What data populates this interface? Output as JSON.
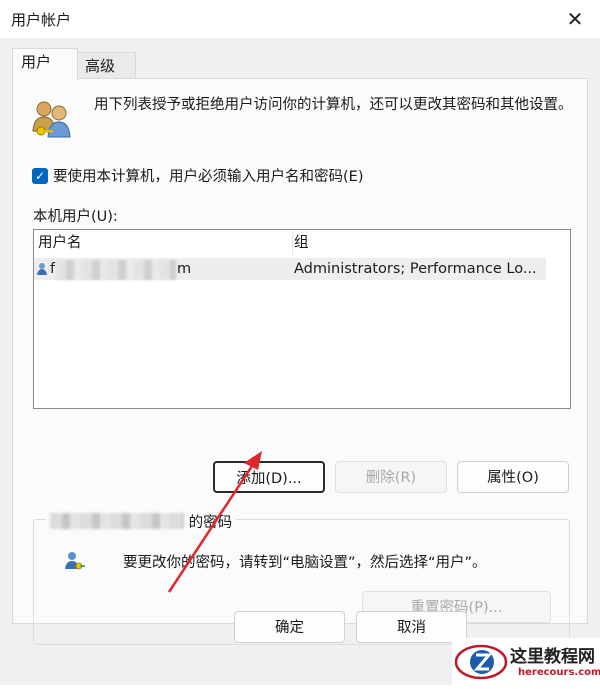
{
  "window": {
    "title": "用户帐户"
  },
  "tabs": [
    {
      "label": "用户"
    },
    {
      "label": "高级"
    }
  ],
  "info": {
    "text": "用下列表授予或拒绝用户访问你的计算机，还可以更改其密码和其他设置。"
  },
  "require_password": {
    "checked": true,
    "label": "要使用本计算机，用户必须输入用户名和密码(E)"
  },
  "local_users": {
    "label": "本机用户(U):",
    "columns": [
      "用户名",
      "组"
    ],
    "rows": [
      {
        "name_start": "f",
        "name_end": "m",
        "group": "Administrators; Performance Lo..."
      }
    ]
  },
  "buttons": {
    "add": "添加(D)...",
    "remove": "删除(R)",
    "properties": "属性(O)",
    "reset_password": "重置密码(P)...",
    "ok": "确定",
    "cancel": "取消"
  },
  "password_section": {
    "title_suffix": " 的密码",
    "text": "要更改你的密码，请转到“电脑设置”，然后选择“用户”。"
  },
  "watermark": {
    "site": "这里教程网",
    "url": "herecours.com"
  },
  "colors": {
    "accent": "#0067c0",
    "arrow": "#e0262f"
  },
  "icons": [
    "close-icon",
    "users-icon",
    "user-icon",
    "user-key-icon",
    "checkmark-icon"
  ]
}
